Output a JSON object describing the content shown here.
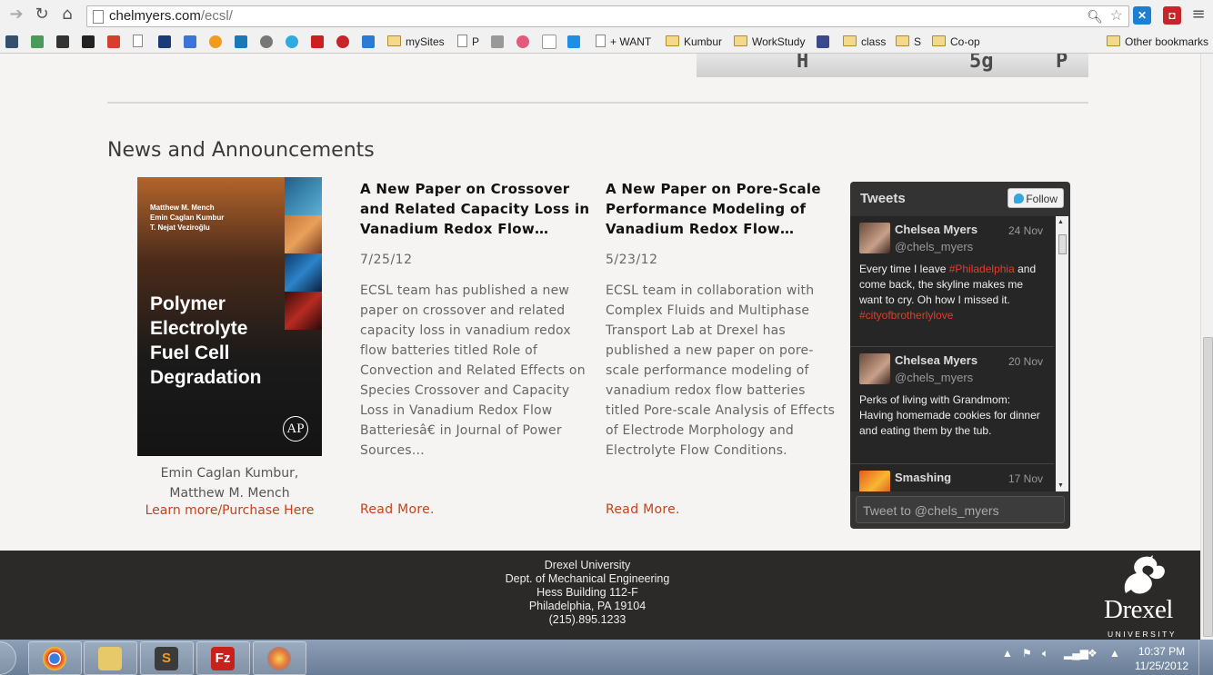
{
  "browser": {
    "url_domain": "chelmyers.com",
    "url_path": "/ecsl/",
    "bookmarks": {
      "mysites": "mySites",
      "p": "P",
      "want": "+ WANT",
      "kumbur": "Kumbur",
      "workstudy": "WorkStudy",
      "class": "class",
      "s": "S",
      "coop": "Co-op",
      "other": "Other bookmarks"
    }
  },
  "section": {
    "title": "News and Announcements"
  },
  "book": {
    "authors_line1": "Matthew M. Mench",
    "authors_line2": "Emin Caglan Kumbur",
    "authors_line3": "T. Nejat Veziroğlu",
    "title_line1": "Polymer",
    "title_line2": "Electrolyte",
    "title_line3": "Fuel Cell",
    "title_line4": "Degradation",
    "publisher_mark": "AP",
    "caption_line1": "Emin Caglan Kumbur,",
    "caption_line2": "Matthew M. Mench",
    "link": "Learn more/Purchase Here"
  },
  "articles": [
    {
      "title": "A New Paper on Crossover and Related Capacity Loss in Vanadium Redox Flow…",
      "date": "7/25/12",
      "body": "ECSL team has published a new paper on crossover and related capacity loss in vanadium redox flow batteries titled Role of Convection and Related Effects on Species Crossover and Capacity Loss in Vanadium Redox Flow Batteriesâ€ in Journal of Power Sources…",
      "read_more": "Read More."
    },
    {
      "title": "A New Paper on Pore-Scale Performance Modeling of Vanadium Redox Flow…",
      "date": "5/23/12",
      "body": "ECSL team in collaboration with Complex Fluids and Multiphase Transport Lab at Drexel has published a new paper on pore-scale performance modeling of vanadium redox flow batteries titled Pore-scale Analysis of Effects of Electrode Morphology and Electrolyte Flow Conditions.",
      "read_more": "Read More."
    }
  ],
  "twitter": {
    "header": "Tweets",
    "follow": "Follow",
    "tweets": [
      {
        "name": "Chelsea Myers",
        "handle": "@chels_myers",
        "time": "24 Nov",
        "text_pre": "Every time I leave ",
        "tag1": "#Philadelphia",
        "text_mid": " and come back, the skyline makes me want to cry. Oh how I missed it. ",
        "tag2": "#cityofbrotherlylove"
      },
      {
        "name": "Chelsea Myers",
        "handle": "@chels_myers",
        "time": "20 Nov",
        "text": "Perks of living with Grandmom: Having homemade cookies for dinner and eating them by the tub."
      },
      {
        "name": "Smashing",
        "time": "17 Nov"
      }
    ],
    "compose_placeholder": "Tweet to @chels_myers"
  },
  "footer": {
    "line1": "Drexel University",
    "line2": "Dept. of Mechanical Engineering",
    "line3": "Hess Building 112-F",
    "line4": "Philadelphia, PA 19104",
    "line5": "(215).895.1233",
    "logo_word": "Drexel",
    "logo_sub": "UNIVERSITY"
  },
  "taskbar": {
    "time": "10:37 PM",
    "date": "11/25/2012"
  }
}
